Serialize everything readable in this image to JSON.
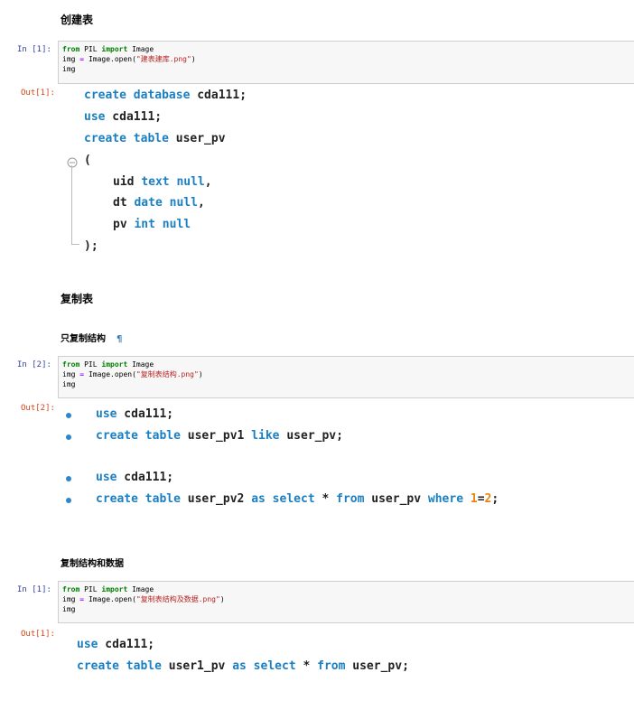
{
  "headings": {
    "create_table": "创建表",
    "copy_table": "复制表",
    "copy_structure_only": "只复制结构",
    "copy_structure_and_data": "复制结构和数据",
    "pilcrow": "¶"
  },
  "cells": [
    {
      "in_prompt": "In  [1]:",
      "out_prompt": "Out[1]:",
      "code": {
        "from": "from",
        "module": "PIL",
        "import": "import",
        "name": "Image",
        "line2_prefix": "img",
        "eq": "=",
        "line2_call": "Image.open(",
        "filename": "\"建表建库.png\"",
        "close": ")",
        "line3": "img"
      }
    },
    {
      "in_prompt": "In  [2]:",
      "out_prompt": "Out[2]:",
      "code": {
        "from": "from",
        "module": "PIL",
        "import": "import",
        "name": "Image",
        "line2_prefix": "img",
        "eq": "=",
        "line2_call": "Image.open(",
        "filename": "\"复制表结构.png\"",
        "close": ")",
        "line3": "img"
      }
    },
    {
      "in_prompt": "In  [1]:",
      "out_prompt": "Out[1]:",
      "code": {
        "from": "from",
        "module": "PIL",
        "import": "import",
        "name": "Image",
        "line2_prefix": "img",
        "eq": "=",
        "line2_call": "Image.open(",
        "filename": "\"复制表结构及数据.png\"",
        "close": ")",
        "line3": "img"
      }
    }
  ],
  "output1": {
    "l1_kw": "create database",
    "l1_rest": " cda111;",
    "l2_kw": "use",
    "l2_rest": " cda111;",
    "l3_kw": "create table",
    "l3_rest": " user_pv",
    "l4": "(",
    "l5_a": "uid ",
    "l5_kw": "text null",
    "l5_b": ",",
    "l6_a": "dt ",
    "l6_kw": "date null",
    "l6_b": ",",
    "l7_a": "pv ",
    "l7_kw": "int null",
    "l8": ");"
  },
  "output2": {
    "b1_kw": "use",
    "b1_rest": " cda111;",
    "b2_kw": "create table",
    "b2_mid": " user_pv1 ",
    "b2_kw2": "like",
    "b2_rest": " user_pv;",
    "b3_kw": "use",
    "b3_rest": " cda111;",
    "b4_kw": "create table",
    "b4_mid": " user_pv2 ",
    "b4_kw2": "as select",
    "b4_star": " * ",
    "b4_kw3": "from",
    "b4_tbl": " user_pv ",
    "b4_kw4": "where",
    "b4_sp": " ",
    "b4_n1": "1",
    "b4_eq": "=",
    "b4_n2": "2",
    "b4_end": ";"
  },
  "output3": {
    "l1_kw": "use",
    "l1_rest": " cda111;",
    "l2_kw": "create table",
    "l2_mid": " user1_pv ",
    "l2_kw2": "as select",
    "l2_star": " * ",
    "l2_kw3": "from",
    "l2_rest": " user_pv;"
  }
}
